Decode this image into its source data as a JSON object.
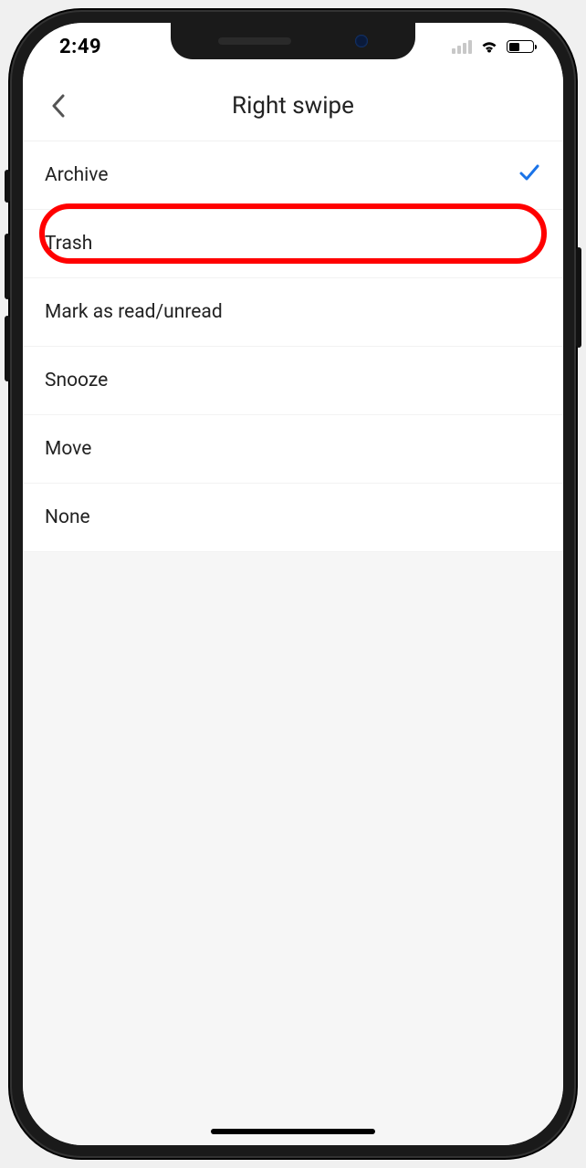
{
  "status": {
    "time": "2:49"
  },
  "header": {
    "title": "Right swipe"
  },
  "options": [
    {
      "label": "Archive",
      "selected": true
    },
    {
      "label": "Trash",
      "selected": false,
      "highlighted": true
    },
    {
      "label": "Mark as read/unread",
      "selected": false
    },
    {
      "label": "Snooze",
      "selected": false
    },
    {
      "label": "Move",
      "selected": false
    },
    {
      "label": "None",
      "selected": false
    }
  ],
  "colors": {
    "accent": "#1a73e8",
    "highlight": "#ff0000"
  }
}
